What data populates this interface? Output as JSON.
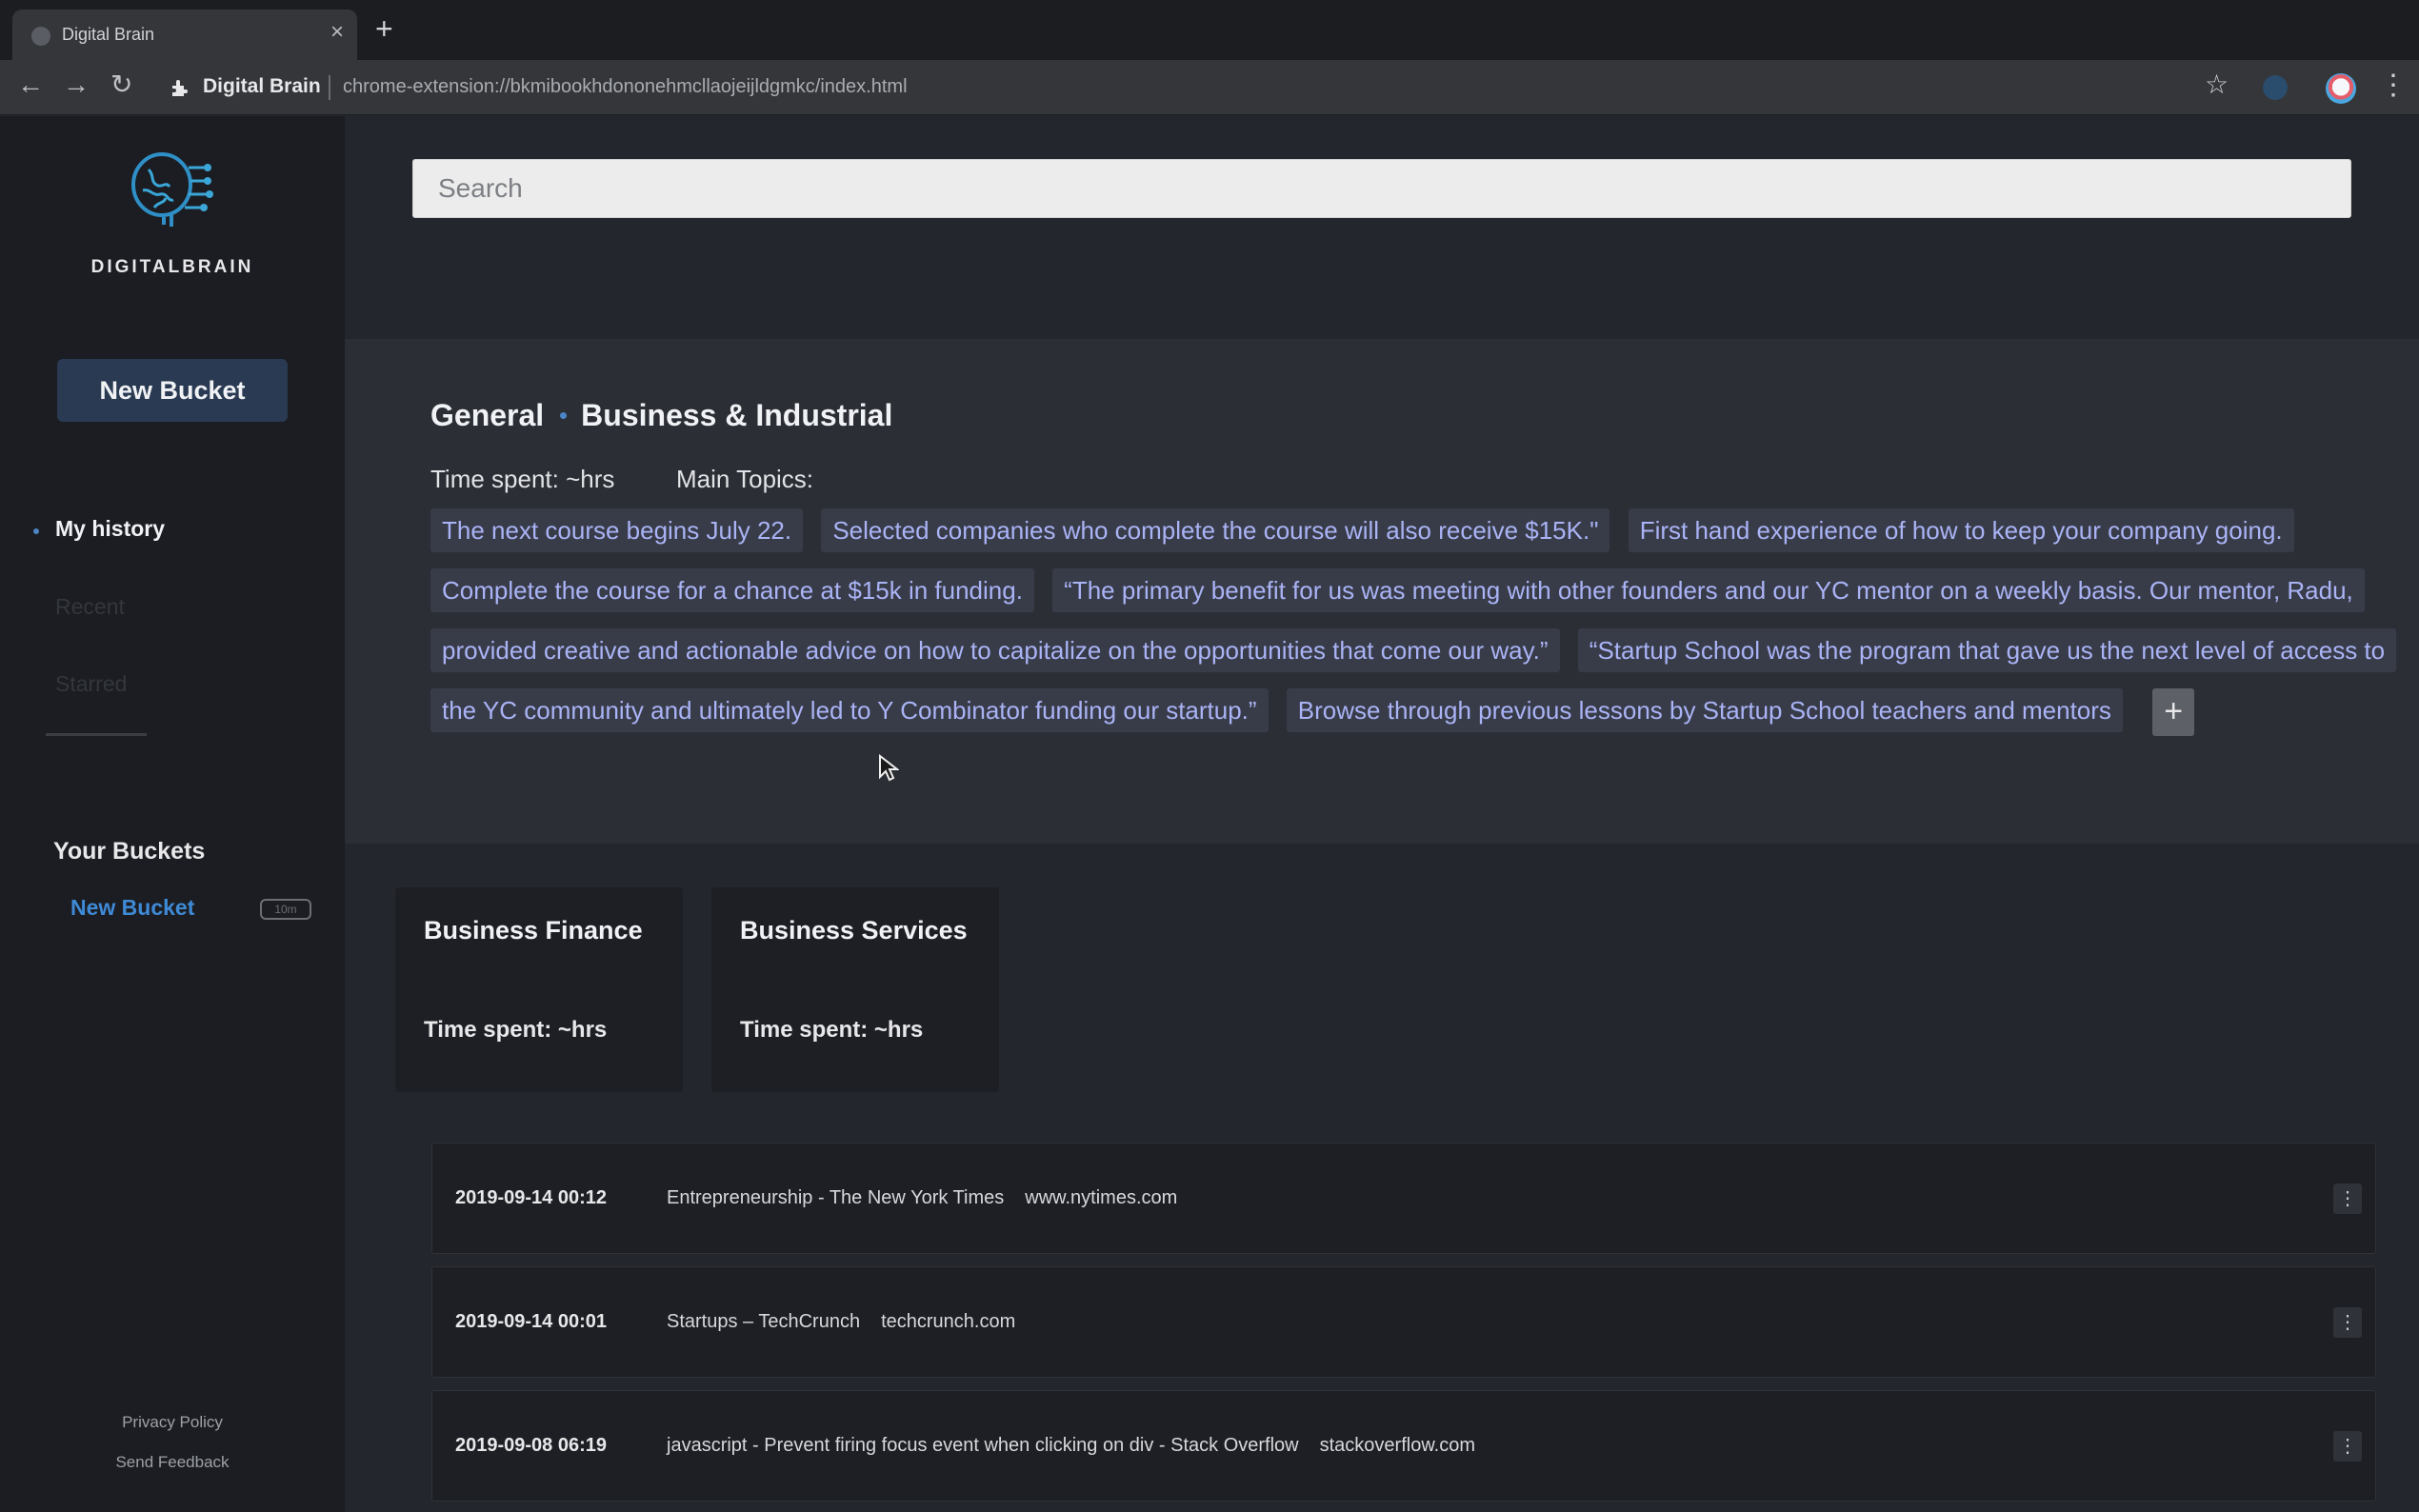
{
  "browser": {
    "tab_title": "Digital Brain",
    "tab_close": "×",
    "new_tab": "+",
    "site_name": "Digital Brain",
    "url": "chrome-extension://bkmibookhdononehmcllaojeijldgmkc/index.html",
    "back": "←",
    "forward": "→",
    "reload": "↻",
    "star": "☆",
    "menu": "⋮"
  },
  "sidebar": {
    "brand": "DIGITALBRAIN",
    "new_bucket_label": "New Bucket",
    "nav": [
      {
        "label": "My history"
      },
      {
        "label": "Recent"
      },
      {
        "label": "Starred"
      }
    ],
    "your_buckets_heading": "Your Buckets",
    "buckets": [
      {
        "label": "New Bucket",
        "badge": "10m"
      }
    ],
    "footer": {
      "privacy": "Privacy Policy",
      "feedback": "Send Feedback"
    }
  },
  "search": {
    "placeholder": "Search"
  },
  "topic": {
    "crumb_primary": "General",
    "crumb_secondary": "Business & Industrial",
    "time_spent": "Time spent: ~hrs",
    "main_topics_label": "Main Topics:",
    "tags": [
      "The next course begins July 22.",
      "Selected companies who complete the course will also receive $15K.\"",
      "First hand experience of how to keep your company going.",
      "Complete the course for a chance at $15k in funding.",
      "“The primary benefit for us was meeting with other founders and our YC mentor on a weekly basis. Our mentor, Radu, provided creative and actionable advice on how to capitalize on the opportunities that come our way.”",
      "“Startup School was the program that gave us the next level of access to the YC community and ultimately led to Y Combinator funding our startup.”",
      "Browse through previous lessons by Startup School teachers and mentors"
    ],
    "add_tag": "+"
  },
  "subcategories": [
    {
      "title": "Business Finance",
      "time": "Time spent: ~hrs"
    },
    {
      "title": "Business Services",
      "time": "Time spent: ~hrs"
    }
  ],
  "history": [
    {
      "date": "2019-09-14 00:12",
      "title": "Entrepreneurship - The New York Times",
      "domain": "www.nytimes.com"
    },
    {
      "date": "2019-09-14 00:01",
      "title": "Startups – TechCrunch",
      "domain": "techcrunch.com"
    },
    {
      "date": "2019-09-08 06:19",
      "title": "javascript - Prevent firing focus event when clicking on div - Stack Overflow",
      "domain": "stackoverflow.com"
    }
  ],
  "history_menu": "⋮",
  "colors": {
    "accent": "#3f8ad6",
    "tag_text": "#aab3f5",
    "tag_bg": "#383c49",
    "sidebar_bg": "#1b1d22",
    "panel_bg": "#2b2e34"
  }
}
